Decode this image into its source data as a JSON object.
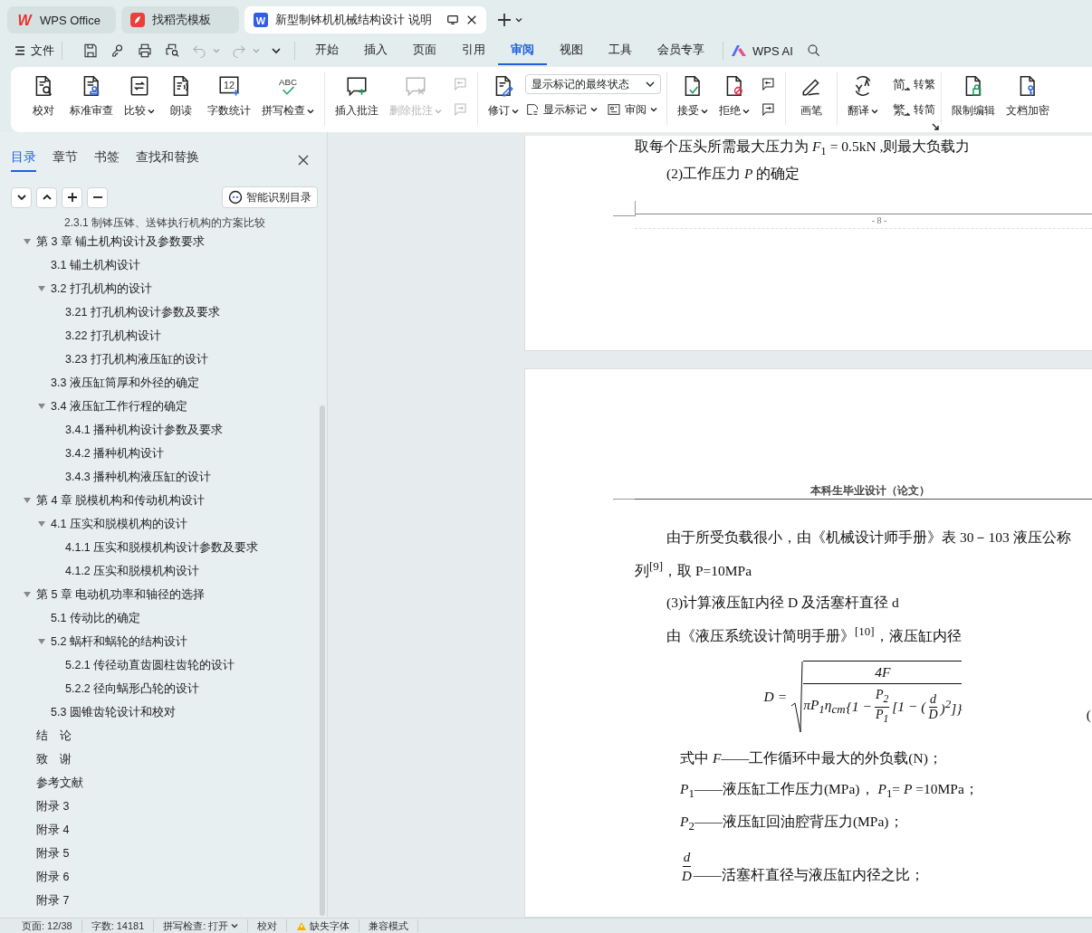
{
  "title_bar": {
    "tabs": [
      {
        "label": "WPS Office",
        "icon_text": "W",
        "selected": false
      },
      {
        "label": "找稻壳模板",
        "selected": false
      },
      {
        "label": "新型制钵机机械结构设计 说明",
        "icon_text": "W",
        "selected": true
      }
    ]
  },
  "menu_bar": {
    "file": "文件",
    "tabs": [
      {
        "label": "开始",
        "selected": false
      },
      {
        "label": "插入",
        "selected": false
      },
      {
        "label": "页面",
        "selected": false
      },
      {
        "label": "引用",
        "selected": false
      },
      {
        "label": "审阅",
        "selected": true
      },
      {
        "label": "视图",
        "selected": false
      },
      {
        "label": "工具",
        "selected": false
      },
      {
        "label": "会员专享",
        "selected": false
      }
    ],
    "ai_button": "WPS AI"
  },
  "ribbon": {
    "groups": [
      {
        "items": [
          {
            "kind": "large",
            "label": "校对",
            "dropdown": false,
            "disabled": false
          },
          {
            "kind": "large",
            "label": "标准审查",
            "dropdown": false,
            "disabled": false
          },
          {
            "kind": "large",
            "label": "比较",
            "dropdown": true,
            "disabled": false
          },
          {
            "kind": "large",
            "label": "朗读",
            "dropdown": false,
            "disabled": false
          },
          {
            "kind": "large",
            "label": "字数统计",
            "icon_text": "12",
            "dropdown": false,
            "disabled": false
          },
          {
            "kind": "large",
            "label": "拼写检查",
            "icon_text": "ABC",
            "dropdown": true,
            "disabled": false
          }
        ]
      },
      {
        "items": [
          {
            "kind": "large",
            "label": "插入批注",
            "dropdown": false,
            "disabled": false
          },
          {
            "kind": "large",
            "label": "删除批注",
            "dropdown": true,
            "disabled": true
          },
          {
            "kind": "icon_stack",
            "buttons": [
              {
                "disabled": true
              },
              {
                "disabled": true
              }
            ]
          }
        ]
      },
      {
        "items": [
          {
            "kind": "large",
            "label": "修订",
            "dropdown": true,
            "disabled": false
          },
          {
            "kind": "select_stack",
            "value": "显示标记的最终状态",
            "buttons": [
              {
                "label": "显示标记",
                "dropdown": true
              },
              {
                "label": "审阅",
                "dropdown": true
              }
            ]
          }
        ]
      },
      {
        "items": [
          {
            "kind": "large",
            "label": "接受",
            "dropdown": true,
            "disabled": false
          },
          {
            "kind": "large",
            "label": "拒绝",
            "dropdown": true,
            "disabled": false
          },
          {
            "kind": "icon_stack",
            "buttons": [
              {
                "disabled": false
              },
              {
                "disabled": false
              }
            ]
          }
        ]
      },
      {
        "items": [
          {
            "kind": "large",
            "label": "画笔",
            "dropdown": false,
            "disabled": false
          }
        ]
      },
      {
        "items": [
          {
            "kind": "large",
            "label": "翻译",
            "dropdown": true,
            "disabled": false
          },
          {
            "kind": "small_stack",
            "buttons": [
              {
                "label": "转繁",
                "icon_text": "简",
                "dropdown": false
              },
              {
                "label": "转简",
                "icon_text": "繁",
                "dropdown": false
              }
            ]
          }
        ]
      },
      {
        "items": [
          {
            "kind": "large",
            "label": "限制编辑",
            "dropdown": false,
            "disabled": false
          },
          {
            "kind": "large",
            "label": "文档加密",
            "dropdown": false,
            "disabled": false
          }
        ]
      }
    ]
  },
  "sidebar": {
    "tabs": [
      {
        "label": "目录",
        "selected": true
      },
      {
        "label": "章节",
        "selected": false
      },
      {
        "label": "书签",
        "selected": false
      },
      {
        "label": "查找和替换",
        "selected": false
      }
    ],
    "smart_toc_button": "智能识别目录",
    "cut_off_item": "2.3.1 制钵压钵、送钵执行机构的方案比较",
    "toc": [
      {
        "label": "第 3 章  铺土机构设计及参数要求",
        "expanded": true,
        "children": [
          {
            "label": "3.1  铺土机构设计"
          },
          {
            "label": "3.2  打孔机构的设计",
            "expanded": true,
            "children": [
              {
                "label": "3.21  打孔机构设计参数及要求"
              },
              {
                "label": "3.22  打孔机构设计"
              },
              {
                "label": "3.23  打孔机构液压缸的设计"
              }
            ]
          },
          {
            "label": "3.3  液压缸筒厚和外径的确定"
          },
          {
            "label": "3.4  液压缸工作行程的确定",
            "expanded": true,
            "children": [
              {
                "label": "3.4.1  播种机构设计参数及要求"
              },
              {
                "label": "3.4.2  播种机构设计"
              },
              {
                "label": "3.4.3  播种机构液压缸的设计"
              }
            ]
          }
        ]
      },
      {
        "label": "第 4 章  脱模机构和传动机构设计",
        "expanded": true,
        "children": [
          {
            "label": "4.1  压实和脱模机构的设计",
            "expanded": true,
            "children": [
              {
                "label": "4.1.1  压实和脱模机构设计参数及要求"
              },
              {
                "label": "4.1.2  压实和脱模机构设计"
              }
            ]
          }
        ]
      },
      {
        "label": "第 5 章  电动机功率和轴径的选择",
        "expanded": true,
        "children": [
          {
            "label": "5.1  传动比的确定"
          },
          {
            "label": "5.2  蜗杆和蜗轮的结构设计",
            "expanded": true,
            "children": [
              {
                "label": "5.2.1  传径动直齿圆柱齿轮的设计"
              },
              {
                "label": "5.2.2  径向蜗形凸轮的设计"
              }
            ]
          },
          {
            "label": "5.3 圆锥齿轮设计和校对"
          }
        ]
      },
      {
        "label": "结　论"
      },
      {
        "label": "致　谢"
      },
      {
        "label": "参考文献"
      },
      {
        "label": "附录 3"
      },
      {
        "label": "附录 4"
      },
      {
        "label": "附录 5"
      },
      {
        "label": "附录 6"
      },
      {
        "label": "附录 7"
      }
    ]
  },
  "document": {
    "page_1": {
      "body": [
        {
          "kind": "flush",
          "text": "取每个压头所需最大压力为 *F*$_{1}$ = 0.5kN ,则最大负载力"
        },
        {
          "kind": "indented",
          "text": "(2)工作压力 *P* 的确定"
        }
      ],
      "footer": "- 8 -"
    },
    "page_2": {
      "header": "本科生毕业设计（论文）",
      "body": [
        {
          "kind": "indented",
          "text": "由于所受负载很小，由《机械设计师手册》表 30－103 液压公称"
        },
        {
          "kind": "flush",
          "text": "列$^{[9]}$，取 P=10MPa"
        },
        {
          "kind": "indented",
          "text": "(3)计算液压缸内径 D 及活塞杆直径 d"
        },
        {
          "kind": "indented",
          "text": "由《液压系统设计简明手册》$^{[10]}$，液压缸内径"
        },
        {
          "kind": "formula",
          "lhs": "D =",
          "numerator": "4F",
          "denominator": [
            {
              "kind": "text",
              "text": "πP$_{1}$η$_{cm}$"
            },
            {
              "kind": "text",
              "text": "{1 −"
            },
            {
              "kind": "fraction",
              "num": "P$_{2}$",
              "den": "P$_{1}$"
            },
            {
              "kind": "text",
              "text": "[1 − ("
            },
            {
              "kind": "fraction",
              "num": "d",
              "den": "D"
            },
            {
              "kind": "text",
              "text": ")$^{2}$]}"
            }
          ],
          "number": "("
        },
        {
          "kind": "definition",
          "text": "式中  *F*——工作循环中最大的外负载(N)；"
        },
        {
          "kind": "definition",
          "text": "*P*$_{1}$——液压缸工作压力(MPa)， *P*$_{1}$= *P* =10MPa；"
        },
        {
          "kind": "definition",
          "text": "*P*$_{2}$——液压缸回油腔背压力(MPa)；"
        },
        {
          "kind": "fraction_definition",
          "num": "d",
          "den": "D",
          "text": "——活塞杆直径与液压缸内径之比；"
        }
      ]
    }
  },
  "status_bar": [
    {
      "text": "页面: 12/38",
      "kind": "plain"
    },
    {
      "text": "字数: 14181",
      "kind": "plain"
    },
    {
      "text": "拼写检查: 打开",
      "kind": "dropdown"
    },
    {
      "text": "校对",
      "kind": "plain"
    },
    {
      "text": "缺失字体",
      "kind": "warning"
    },
    {
      "text": "兼容模式",
      "kind": "plain"
    }
  ]
}
